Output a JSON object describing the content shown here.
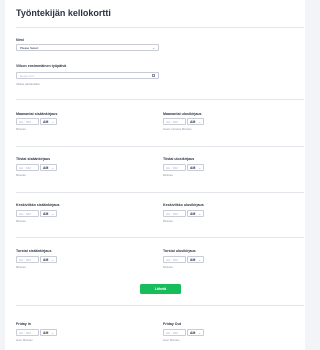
{
  "form": {
    "title": "Työntekijän kellokortti",
    "name_label": "Nimi",
    "name_select": "Please Select",
    "week_label": "Viikon ensimmäinen työpäivä",
    "week_placeholder": "kk-pp-vvvv",
    "week_sub": "Valitse päivämäärä",
    "submit": "Lähetä"
  },
  "time_placeholder": "HH : MM",
  "ampm": "AM",
  "days": [
    {
      "in_label": "Maanantai sisäänkirjaus",
      "in_sub": "Minutes",
      "out_label": "Maanantai ulosikirjaus",
      "out_sub": "Hours minutes Minutes"
    },
    {
      "in_label": "Tiistai sisäänkirjaus",
      "in_sub": "Minutes",
      "out_label": "Tiistai ulosikirjaus",
      "out_sub": "Minutes"
    },
    {
      "in_label": "Keskiviikko sisäänkirjaus",
      "in_sub": "Minutes",
      "out_label": "Keskiviikko ulosikirjaus",
      "out_sub": "Minutes"
    },
    {
      "in_label": "Torstai sisäänkirjaus",
      "in_sub": "Minutes",
      "out_label": "Torstai ulosikirjaus",
      "out_sub": "Minutes"
    },
    {
      "in_label": "Friday In",
      "in_sub": "Hour Minutes",
      "out_label": "Friday Out",
      "out_sub": "Hour Minutes"
    }
  ]
}
